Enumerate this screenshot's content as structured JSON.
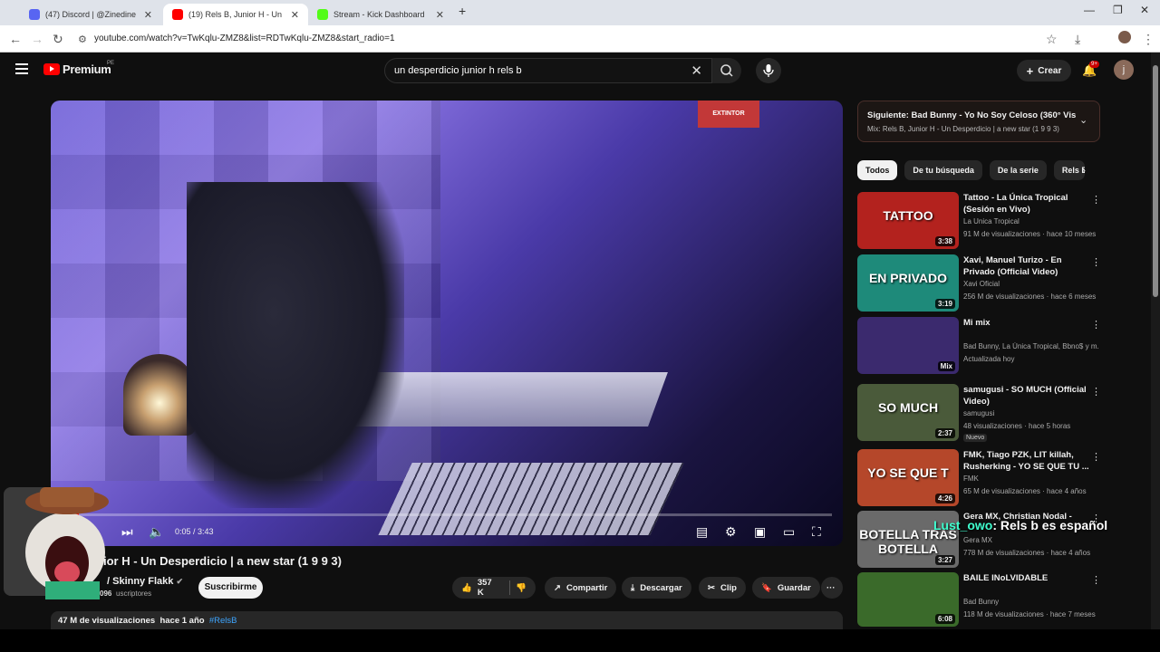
{
  "browser": {
    "tabs": [
      {
        "label": "(47) Discord | @Zinedine ◊",
        "icon": "discord-icon",
        "color": "#5865f2"
      },
      {
        "label": "(19) Rels B, Junior H - Un Desperdicio",
        "icon": "youtube-icon",
        "color": "#ff0000"
      },
      {
        "label": "Stream - Kick Dashboard",
        "icon": "kick-icon",
        "color": "#53fc18"
      }
    ],
    "url": "youtube.com/watch?v=TwKqlu-ZMZ8&list=RDTwKqlu-ZMZ8&start_radio=1"
  },
  "header": {
    "logo": "Premium",
    "region": "PE",
    "search_query": "un desperdicio junior h rels b",
    "create_label": "Crear",
    "notifications": "9+",
    "avatar_letter": "j"
  },
  "player": {
    "sign": "EXTINTOR",
    "time": "0:05 / 3:43",
    "progress": 0.022
  },
  "video": {
    "title": "ior H - Un Desperdicio | a new star (1 9 9 3)",
    "channel": "/ Skinny Flakk",
    "subscribers": "uscriptores",
    "subscribe_label": "Suscribirme",
    "likes": "357 K",
    "share_label": "Compartir",
    "download_label": "Descargar",
    "clip_label": "Clip",
    "save_label": "Guardar",
    "views": "47 M de visualizaciones",
    "age": "hace 1 año",
    "hashtag": "#RelsB"
  },
  "next": {
    "title": "Siguiente: Bad Bunny - Yo No Soy Celoso (360° Vis...",
    "mix": "Mix: Rels B, Junior H - Un Desperdicio | a new star (1 9 9 3)"
  },
  "chips": [
    "Todos",
    "De tu búsqueda",
    "De la serie",
    "Rels B"
  ],
  "related": [
    {
      "title": "Tattoo - La Única Tropical (Sesión en Vivo)",
      "channel": "La Unica Tropical",
      "meta": "91 M de visualizaciones · hace 10 meses",
      "duration": "3:38",
      "thumb_text": "TATTOO",
      "bg": "#b3221e"
    },
    {
      "title": "Xavi, Manuel Turizo - En Privado (Official Video)",
      "channel": "Xavi Oficial",
      "meta": "256 M de visualizaciones · hace 6 meses",
      "duration": "3:19",
      "thumb_text": "EN PRIVADO",
      "bg": "#1e8a7a"
    },
    {
      "title": "Mi mix",
      "channel": "Bad Bunny, La Única Tropical, Bbno$ y m...",
      "meta": "Actualizada hoy",
      "duration": "Mix",
      "thumb_text": "",
      "bg": "#3b2a6e"
    },
    {
      "title": "samugusi - SO MUCH (Official Video)",
      "channel": "samugusi",
      "meta": "48 visualizaciones · hace 5 horas",
      "duration": "2:37",
      "thumb_text": "SO MUCH",
      "bg": "#4a5a3a",
      "badge": "Nuevo"
    },
    {
      "title": "FMK, Tiago PZK, LIT killah, Rusherking - YO SE QUE TU ...",
      "channel": "FMK",
      "meta": "65 M de visualizaciones · hace 4 años",
      "duration": "4:26",
      "thumb_text": "YO SE QUE T",
      "bg": "#b5472a"
    },
    {
      "title": "Gera MX, Christian Nodal -",
      "channel": "Gera MX",
      "meta": "778 M de visualizaciones · hace 4 años",
      "duration": "3:27",
      "thumb_text": "BOTELLA TRAS BOTELLA",
      "bg": "#6a6a6a"
    },
    {
      "title": "BAILE INoLVIDABLE",
      "channel": "Bad Bunny",
      "meta": "118 M de visualizaciones · hace 7 meses",
      "duration": "6:08",
      "thumb_text": "",
      "bg": "#3a6a2a"
    }
  ],
  "overlay": {
    "name": "Lust_owo",
    "message": ": Rels b es español",
    "cat_count": "096"
  }
}
